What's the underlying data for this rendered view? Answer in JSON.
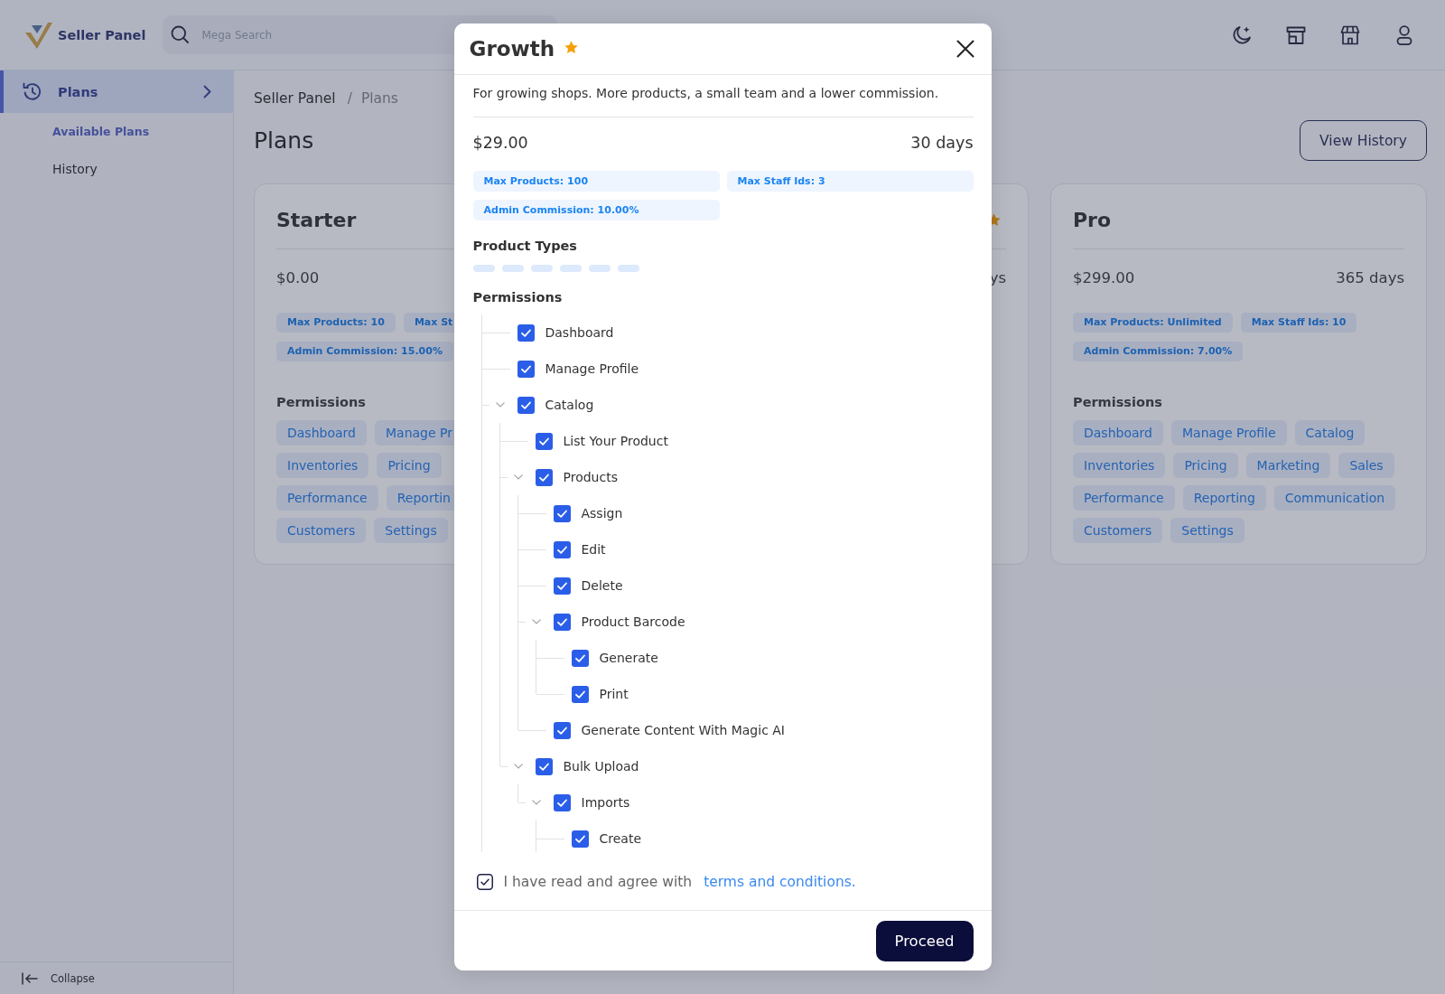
{
  "header": {
    "brand": "Seller Panel",
    "search": {
      "placeholder": "Mega Search"
    }
  },
  "sidebar": {
    "items": [
      {
        "label": "Plans",
        "selected": true,
        "children": [
          {
            "label": "Available Plans",
            "selected": true
          },
          {
            "label": "History",
            "selected": false
          }
        ]
      }
    ],
    "collapse": "Collapse"
  },
  "breadcrumb": {
    "items": [
      "Seller Panel",
      "Plans"
    ],
    "separator": "/"
  },
  "page": {
    "title": "Plans",
    "view_history_button": "View History"
  },
  "plans": [
    {
      "name": "Starter",
      "price": "$0.00",
      "tag_rows": [
        [
          "Max Products: 10",
          "Max St"
        ],
        [
          "Admin Commission: 15.00%"
        ]
      ],
      "permissions_heading": "Permissions",
      "permission_rows": [
        [
          "Dashboard",
          "Manage Pr"
        ],
        [
          "Inventories",
          "Pricing"
        ],
        [
          "Performance",
          "Reportin"
        ],
        [
          "Customers",
          "Settings"
        ]
      ]
    },
    {
      "starred": true,
      "duration": "ys"
    },
    {
      "name": "Pro",
      "starred": false,
      "price": "$299.00",
      "duration": "365 days",
      "tag_rows": [
        [
          "Max Products: Unlimited",
          "Max Staff Ids: 10"
        ],
        [
          "Admin Commission: 7.00%"
        ]
      ],
      "permissions_heading": "Permissions",
      "permission_rows": [
        [
          "Dashboard",
          "Manage Profile",
          "Catalog"
        ],
        [
          "Inventories",
          "Pricing",
          "Marketing",
          "Sales"
        ],
        [
          "Performance",
          "Reporting",
          "Communication"
        ],
        [
          "Customers",
          "Settings"
        ]
      ]
    }
  ],
  "modal": {
    "title": "Growth",
    "starred": true,
    "description": "For growing shops. More products, a small team and a lower commission.",
    "price": "$29.00",
    "duration": "30 days",
    "tags": [
      "Max Products: 100",
      "Max Staff Ids: 3",
      "Admin Commission: 10.00%"
    ],
    "product_types": {
      "heading": "Product Types",
      "items": [
        {
          "kind": "skeleton"
        },
        {
          "kind": "skeleton"
        },
        {
          "kind": "skeleton"
        },
        {
          "kind": "skeleton"
        },
        {
          "kind": "skeleton"
        },
        {
          "kind": "skeleton"
        }
      ]
    },
    "permissions": {
      "heading": "Permissions",
      "tree": [
        {
          "label": "Dashboard",
          "checked": true
        },
        {
          "label": "Manage Profile",
          "checked": true
        },
        {
          "label": "Catalog",
          "checked": true,
          "expanded": true,
          "more_below": true,
          "children": [
            {
              "label": "List Your Product",
              "checked": true
            },
            {
              "label": "Products",
              "checked": true,
              "expanded": true,
              "children": [
                {
                  "label": "Assign",
                  "checked": true
                },
                {
                  "label": "Edit",
                  "checked": true
                },
                {
                  "label": "Delete",
                  "checked": true
                },
                {
                  "label": "Product Barcode",
                  "checked": true,
                  "expanded": true,
                  "children": [
                    {
                      "label": "Generate",
                      "checked": true
                    },
                    {
                      "label": "Print",
                      "checked": true
                    }
                  ]
                },
                {
                  "label": "Generate Content With Magic AI",
                  "checked": true
                }
              ]
            },
            {
              "label": "Bulk Upload",
              "checked": true,
              "expanded": true,
              "children": [
                {
                  "label": "Imports",
                  "checked": true,
                  "expanded": true,
                  "children": [
                    {
                      "label": "Create",
                      "checked": true,
                      "more_below": true
                    }
                  ]
                }
              ]
            }
          ]
        }
      ]
    },
    "agreement": {
      "checked": true,
      "text": "I have read and agree with",
      "link": "terms and conditions."
    },
    "proceed_button": "Proceed"
  }
}
